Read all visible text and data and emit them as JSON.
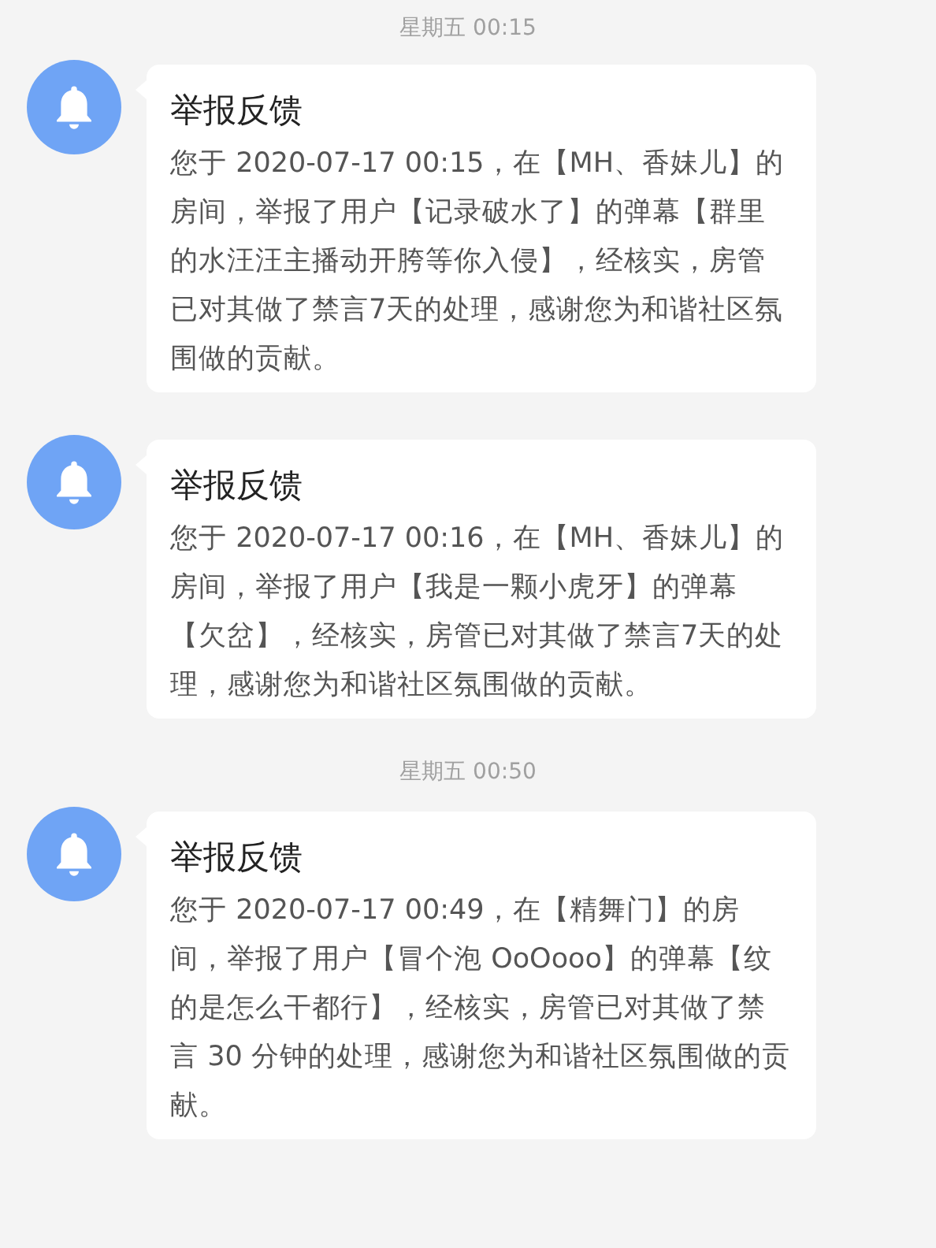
{
  "messages": [
    {
      "kind": "timestamp",
      "text": "星期五 00:15"
    },
    {
      "kind": "notice",
      "title": "举报反馈",
      "body": "您于 2020-07-17 00:15，在【MH、香妹儿】的房间，举报了用户【记录破水了】的弹幕【群里的水汪汪主播动开胯等你入侵】，经核实，房管已对其做了禁言7天的处理，感谢您为和谐社区氛围做的贡献。"
    },
    {
      "kind": "notice",
      "title": "举报反馈",
      "body": "您于 2020-07-17 00:16，在【MH、香妹儿】的房间，举报了用户【我是一颗小虎牙】的弹幕【欠岔】，经核实，房管已对其做了禁言7天的处理，感谢您为和谐社区氛围做的贡献。"
    },
    {
      "kind": "timestamp",
      "text": "星期五 00:50"
    },
    {
      "kind": "notice",
      "title": "举报反馈",
      "body": "您于 2020-07-17 00:49，在【精舞门】的房间，举报了用户【冒个泡 OoOooo】的弹幕【纹的是怎么干都行】，经核实，房管已对其做了禁言 30 分钟的处理，感谢您为和谐社区氛围做的贡献。"
    }
  ]
}
